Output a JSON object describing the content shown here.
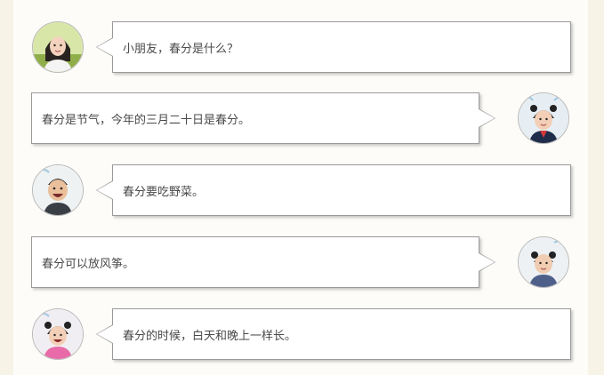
{
  "messages": [
    {
      "side": "left",
      "text": "小朋友，春分是什么？"
    },
    {
      "side": "right",
      "text": "春分是节气，今年的三月二十日是春分。"
    },
    {
      "side": "left",
      "text": "春分要吃野菜。"
    },
    {
      "side": "right",
      "text": "春分可以放风筝。"
    },
    {
      "side": "left",
      "text": "春分的时候，白天和晚上一样长。"
    }
  ],
  "colors": {
    "page_background": "#f7f3e6",
    "panel_background": "#fdfcf8",
    "bubble_border": "#9a9a9a",
    "text": "#4a4a4a"
  }
}
